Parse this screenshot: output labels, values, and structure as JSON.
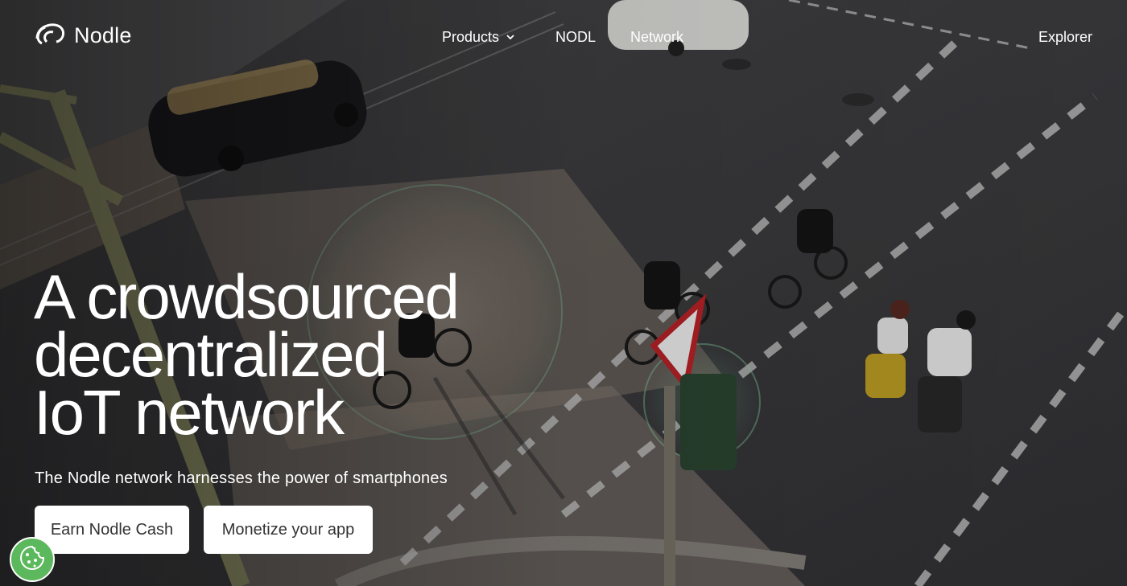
{
  "brand": {
    "name": "Nodle"
  },
  "nav": {
    "products": "Products",
    "nodl": "NODL",
    "network": "Network",
    "explorer": "Explorer"
  },
  "hero": {
    "headline_lines": [
      "A crowdsourced",
      "decentralized",
      "IoT network"
    ],
    "subtitle": "The Nodle network harnesses the power of smartphones",
    "buttons": {
      "earn": "Earn Nodle Cash",
      "monetize": "Monetize your app"
    }
  },
  "colors": {
    "accent": "#5cb85c",
    "text": "#ffffff",
    "button_bg": "#ffffff",
    "button_text": "#333333"
  },
  "icons": {
    "logo": "nodle-logo-icon",
    "dropdown": "chevron-down-icon",
    "cookie": "cookie-icon"
  }
}
